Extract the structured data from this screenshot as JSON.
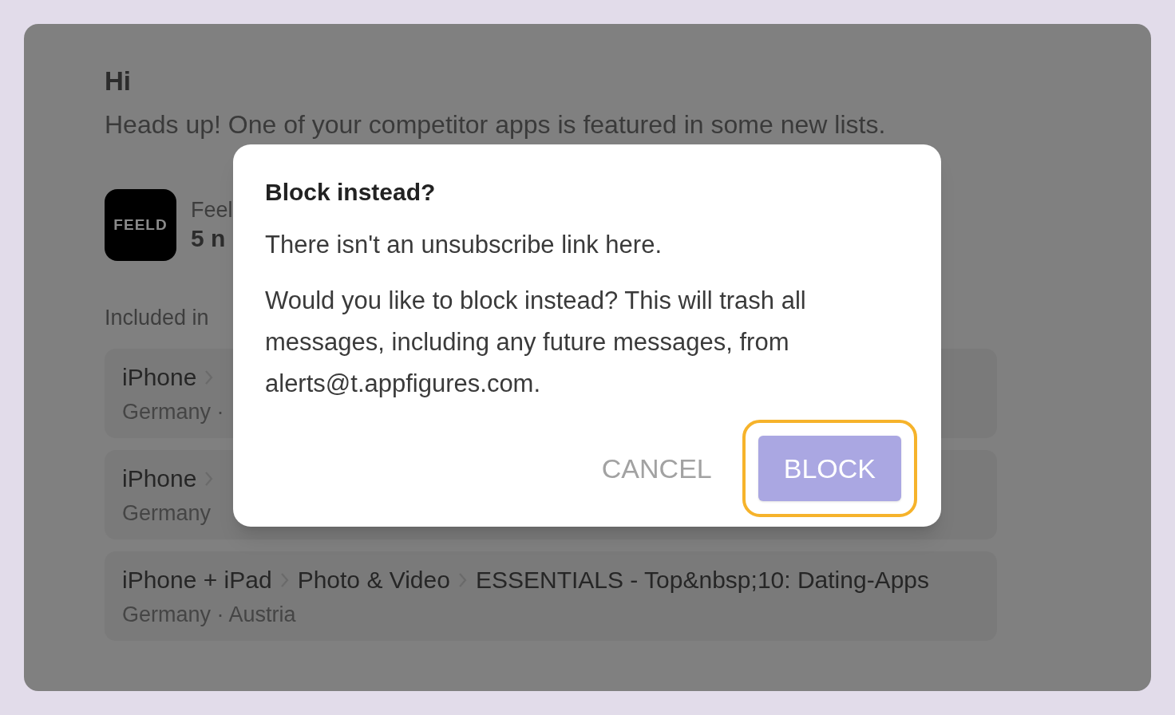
{
  "email": {
    "greeting": "Hi",
    "intro": "Heads up! One of your competitor apps is featured in some new lists.",
    "app": {
      "logo_text": "FEELD",
      "name": "Feel",
      "subtitle": "5 n"
    },
    "included_label": "Included in",
    "lists": [
      {
        "path": [
          "iPhone"
        ],
        "cut": true,
        "regions": "Germany ·"
      },
      {
        "path": [
          "iPhone"
        ],
        "cut": true,
        "regions": "Germany"
      },
      {
        "path": [
          "iPhone + iPad",
          "Photo & Video",
          "ESSENTIALS - Top&nbsp;10: Dating-Apps"
        ],
        "cut": false,
        "regions": "Germany · Austria"
      }
    ]
  },
  "dialog": {
    "title": "Block instead?",
    "paragraphs": [
      "There isn't an unsubscribe link here.",
      "Would you like to block instead? This will trash all messages, including any future messages, from alerts@t.appfigures.com."
    ],
    "buttons": [
      {
        "label": "CANCEL",
        "kind": "text",
        "focused": false
      },
      {
        "label": "BLOCK",
        "kind": "primary",
        "focused": true
      }
    ]
  }
}
